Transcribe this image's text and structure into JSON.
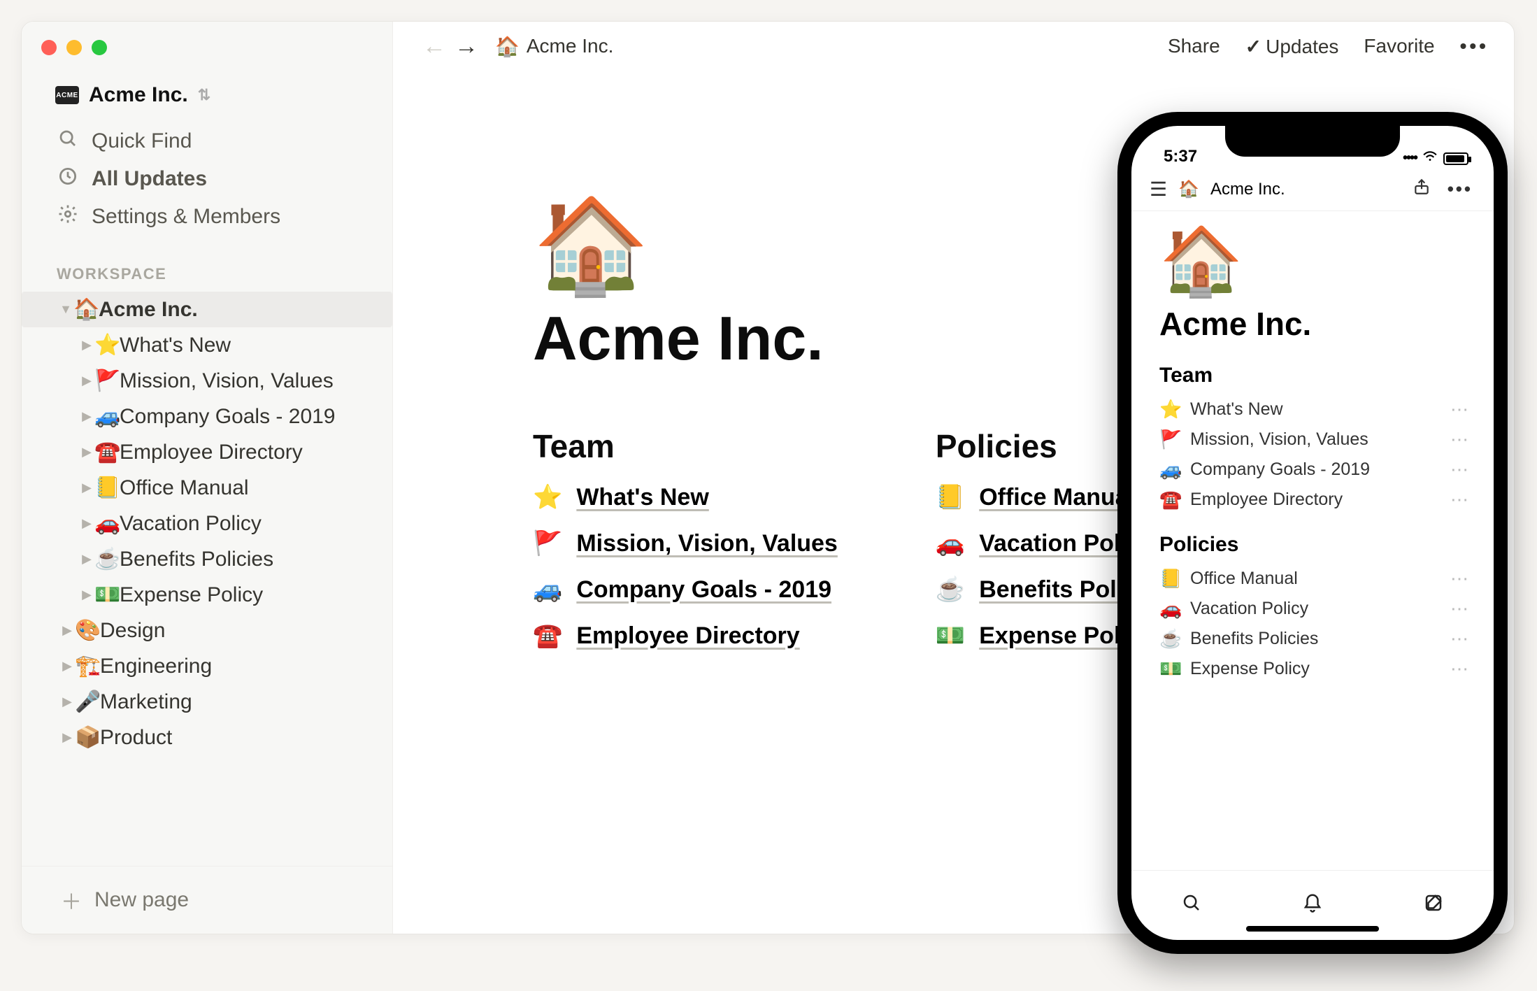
{
  "workspace": {
    "name": "Acme Inc.",
    "badge_label": "ACME",
    "nav": {
      "quick_find": "Quick Find",
      "all_updates": "All Updates",
      "settings_members": "Settings & Members"
    },
    "section_label": "WORKSPACE"
  },
  "sidebar": {
    "root": {
      "emoji": "🏠",
      "label": "Acme Inc."
    },
    "children": [
      {
        "emoji": "⭐",
        "label": "What's New"
      },
      {
        "emoji": "🚩",
        "label": "Mission, Vision, Values"
      },
      {
        "emoji": "🚙",
        "label": "Company Goals - 2019"
      },
      {
        "emoji": "☎️",
        "label": "Employee Directory"
      },
      {
        "emoji": "📒",
        "label": "Office Manual"
      },
      {
        "emoji": "🚗",
        "label": "Vacation Policy"
      },
      {
        "emoji": "☕",
        "label": "Benefits Policies"
      },
      {
        "emoji": "💵",
        "label": "Expense Policy"
      }
    ],
    "others": [
      {
        "emoji": "🎨",
        "label": "Design"
      },
      {
        "emoji": "🏗️",
        "label": "Engineering"
      },
      {
        "emoji": "🎤",
        "label": "Marketing"
      },
      {
        "emoji": "📦",
        "label": "Product"
      }
    ],
    "new_page": "New page"
  },
  "topbar": {
    "breadcrumb_emoji": "🏠",
    "breadcrumb": "Acme Inc.",
    "share": "Share",
    "updates": "Updates",
    "favorite": "Favorite"
  },
  "page": {
    "emoji": "🏠",
    "title": "Acme Inc.",
    "columns": [
      {
        "heading": "Team",
        "items": [
          {
            "emoji": "⭐",
            "label": "What's New"
          },
          {
            "emoji": "🚩",
            "label": "Mission, Vision, Values"
          },
          {
            "emoji": "🚙",
            "label": "Company Goals - 2019"
          },
          {
            "emoji": "☎️",
            "label": "Employee Directory"
          }
        ]
      },
      {
        "heading": "Policies",
        "items": [
          {
            "emoji": "📒",
            "label": "Office Manual"
          },
          {
            "emoji": "🚗",
            "label": "Vacation Policy"
          },
          {
            "emoji": "☕",
            "label": "Benefits Policies"
          },
          {
            "emoji": "💵",
            "label": "Expense Policy"
          }
        ]
      }
    ]
  },
  "mobile": {
    "status_time": "5:37",
    "breadcrumb_emoji": "🏠",
    "breadcrumb": "Acme Inc.",
    "title": "Acme Inc.",
    "hero_emoji": "🏠",
    "sections": [
      {
        "heading": "Team",
        "items": [
          {
            "emoji": "⭐",
            "label": "What's New"
          },
          {
            "emoji": "🚩",
            "label": "Mission, Vision, Values"
          },
          {
            "emoji": "🚙",
            "label": "Company Goals - 2019"
          },
          {
            "emoji": "☎️",
            "label": "Employee Directory"
          }
        ]
      },
      {
        "heading": "Policies",
        "items": [
          {
            "emoji": "📒",
            "label": "Office Manual"
          },
          {
            "emoji": "🚗",
            "label": "Vacation Policy"
          },
          {
            "emoji": "☕",
            "label": "Benefits Policies"
          },
          {
            "emoji": "💵",
            "label": "Expense Policy"
          }
        ]
      }
    ]
  }
}
